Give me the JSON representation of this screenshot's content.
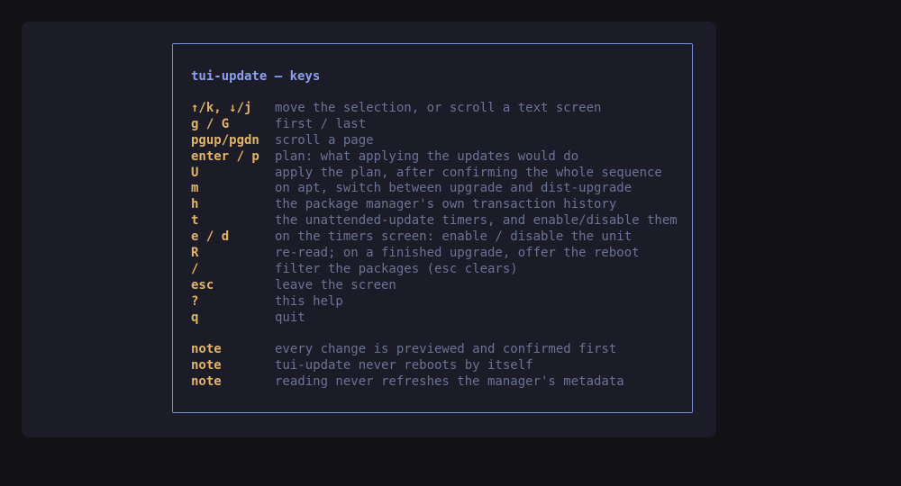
{
  "help": {
    "title": "tui-update — keys",
    "bindings": [
      {
        "key": "↑/k, ↓/j",
        "desc": "move the selection, or scroll a text screen"
      },
      {
        "key": "g / G",
        "desc": "first / last"
      },
      {
        "key": "pgup/pgdn",
        "desc": "scroll a page"
      },
      {
        "key": "enter / p",
        "desc": "plan: what applying the updates would do"
      },
      {
        "key": "U",
        "desc": "apply the plan, after confirming the whole sequence"
      },
      {
        "key": "m",
        "desc": "on apt, switch between upgrade and dist-upgrade"
      },
      {
        "key": "h",
        "desc": "the package manager's own transaction history"
      },
      {
        "key": "t",
        "desc": "the unattended-update timers, and enable/disable them"
      },
      {
        "key": "e / d",
        "desc": "on the timers screen: enable / disable the unit"
      },
      {
        "key": "R",
        "desc": "re-read; on a finished upgrade, offer the reboot"
      },
      {
        "key": "/",
        "desc": "filter the packages (esc clears)"
      },
      {
        "key": "esc",
        "desc": "leave the screen"
      },
      {
        "key": "?",
        "desc": "this help"
      },
      {
        "key": "q",
        "desc": "quit"
      }
    ],
    "notes": [
      {
        "key": "note",
        "desc": "every change is previewed and confirmed first"
      },
      {
        "key": "note",
        "desc": "tui-update never reboots by itself"
      },
      {
        "key": "note",
        "desc": "reading never refreshes the manager's metadata"
      }
    ]
  },
  "colors": {
    "background": "#111116",
    "terminal": "#1c1c28",
    "border": "#7b8fd0",
    "title": "#8aa0ec",
    "key": "#e2b466",
    "description": "#6b7394"
  }
}
